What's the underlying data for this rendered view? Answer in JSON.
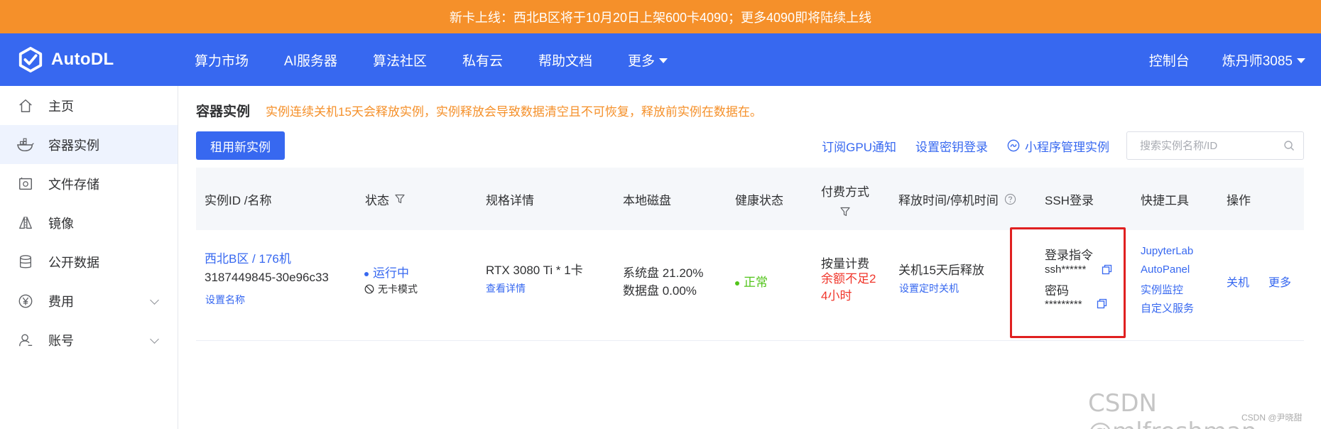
{
  "announcement": "新卡上线：西北B区将于10月20日上架600卡4090；更多4090即将陆续上线",
  "brand": {
    "name": "AutoDL",
    "accent": "#3768f0",
    "warning": "#f5902a"
  },
  "nav": {
    "items": [
      "算力市场",
      "AI服务器",
      "算法社区",
      "私有云",
      "帮助文档",
      "更多"
    ],
    "console": "控制台",
    "user": "炼丹师3085"
  },
  "sidebar": {
    "items": [
      {
        "label": "主页",
        "icon": "home-icon"
      },
      {
        "label": "容器实例",
        "icon": "container-icon"
      },
      {
        "label": "文件存储",
        "icon": "file-storage-icon"
      },
      {
        "label": "镜像",
        "icon": "image-mirror-icon"
      },
      {
        "label": "公开数据",
        "icon": "database-icon"
      },
      {
        "label": "费用",
        "icon": "yen-icon"
      },
      {
        "label": "账号",
        "icon": "user-icon"
      }
    ]
  },
  "page": {
    "title": "容器实例",
    "warning": "实例连续关机15天会释放实例，实例释放会导致数据清空且不可恢复，释放前实例在数据在。"
  },
  "toolbar": {
    "new_instance": "租用新实例",
    "gpu_notify": "订阅GPU通知",
    "ssh_key": "设置密钥登录",
    "mini_program": "小程序管理实例",
    "search_placeholder": "搜索实例名称/ID"
  },
  "table": {
    "headers": {
      "id_name": "实例ID /名称",
      "status": "状态",
      "spec": "规格详情",
      "disk": "本地磁盘",
      "health": "健康状态",
      "billing": "付费方式",
      "release": "释放时间/停机时间",
      "ssh": "SSH登录",
      "tools": "快捷工具",
      "ops": "操作"
    },
    "row": {
      "name": "西北B区 / 176机",
      "id": "3187449845-30e96c33",
      "set_name": "设置名称",
      "status": "运行中",
      "mode": "无卡模式",
      "gpu": "RTX 3080 Ti * 1卡",
      "view_details": "查看详情",
      "system_disk": "系统盘 21.20%",
      "data_disk": "数据盘 0.00%",
      "health": "正常",
      "billing": "按量计费",
      "balance_warn": "余额不足24小时",
      "release": "关机15天后释放",
      "timed_shutdown": "设置定时关机",
      "ssh_cmd_label": "登录指令",
      "ssh_cmd": "ssh******",
      "password_label": "密码",
      "password": "*********",
      "tools": [
        "JupyterLab",
        "AutoPanel",
        "实例监控",
        "自定义服务"
      ],
      "shutdown": "关机",
      "more": "更多"
    }
  },
  "watermark": {
    "main": "CSDN @mlfreshman",
    "sub": "CSDN @尹晓甜"
  }
}
